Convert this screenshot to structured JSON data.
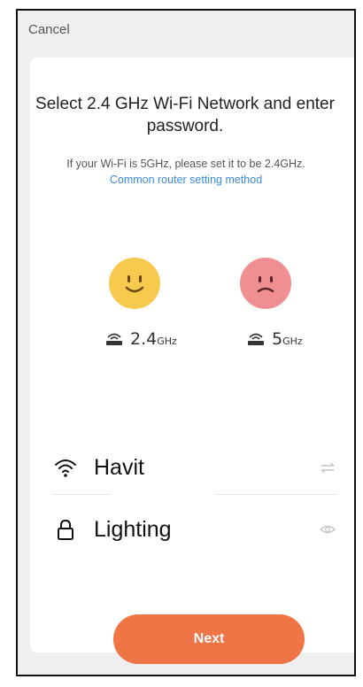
{
  "header": {
    "cancel_label": "Cancel"
  },
  "card": {
    "title": "Select 2.4 GHz Wi-Fi Network and enter password.",
    "subtitle": "If your Wi-Fi is 5GHz, please set it to be 2.4GHz.",
    "subtitle_link": "Common router setting method"
  },
  "frequencies": [
    {
      "icon": "happy-face-icon",
      "router_icon": "router-icon",
      "value": "2.4",
      "unit": "GHz",
      "color": "#f7ca4f"
    },
    {
      "icon": "sad-face-icon",
      "router_icon": "router-icon",
      "value": "5",
      "unit": "GHz",
      "color": "#ef8f92"
    }
  ],
  "form": {
    "ssid": {
      "icon": "wifi-icon",
      "value": "Havit",
      "action_icon": "swap-icon"
    },
    "password": {
      "icon": "lock-icon",
      "value": "Lighting",
      "action_icon": "eye-icon"
    }
  },
  "next_label": "Next",
  "colors": {
    "accent": "#f07546",
    "link": "#3a8be0"
  }
}
